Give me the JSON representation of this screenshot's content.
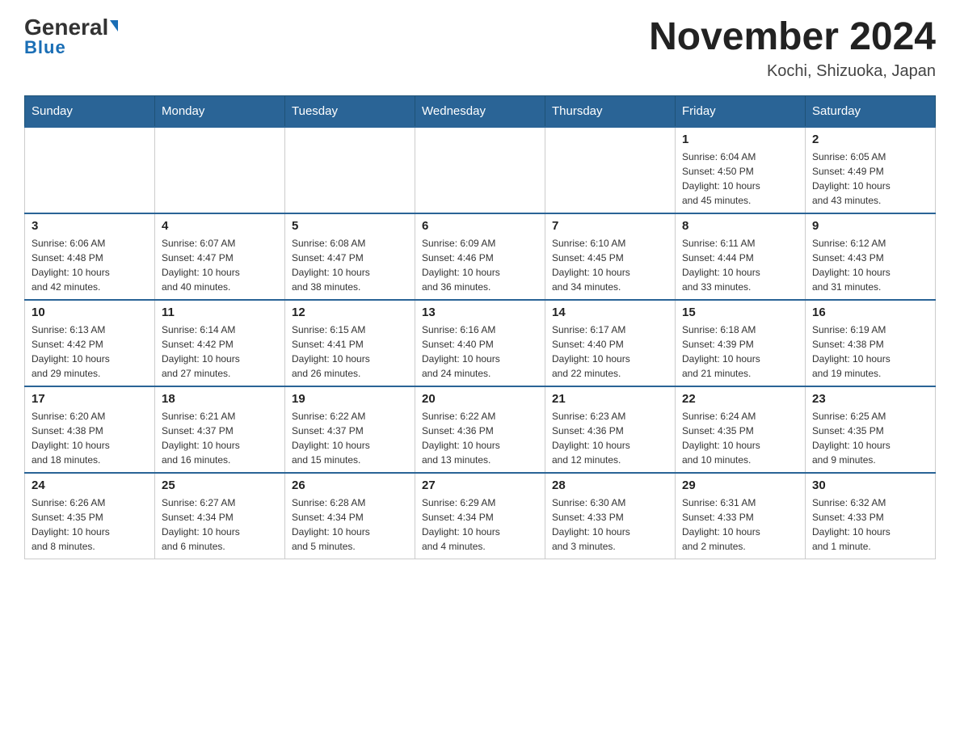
{
  "header": {
    "logo_general": "General",
    "logo_blue": "Blue",
    "month_title": "November 2024",
    "location": "Kochi, Shizuoka, Japan"
  },
  "days_of_week": [
    "Sunday",
    "Monday",
    "Tuesday",
    "Wednesday",
    "Thursday",
    "Friday",
    "Saturday"
  ],
  "weeks": [
    [
      {
        "day": "",
        "info": ""
      },
      {
        "day": "",
        "info": ""
      },
      {
        "day": "",
        "info": ""
      },
      {
        "day": "",
        "info": ""
      },
      {
        "day": "",
        "info": ""
      },
      {
        "day": "1",
        "info": "Sunrise: 6:04 AM\nSunset: 4:50 PM\nDaylight: 10 hours\nand 45 minutes."
      },
      {
        "day": "2",
        "info": "Sunrise: 6:05 AM\nSunset: 4:49 PM\nDaylight: 10 hours\nand 43 minutes."
      }
    ],
    [
      {
        "day": "3",
        "info": "Sunrise: 6:06 AM\nSunset: 4:48 PM\nDaylight: 10 hours\nand 42 minutes."
      },
      {
        "day": "4",
        "info": "Sunrise: 6:07 AM\nSunset: 4:47 PM\nDaylight: 10 hours\nand 40 minutes."
      },
      {
        "day": "5",
        "info": "Sunrise: 6:08 AM\nSunset: 4:47 PM\nDaylight: 10 hours\nand 38 minutes."
      },
      {
        "day": "6",
        "info": "Sunrise: 6:09 AM\nSunset: 4:46 PM\nDaylight: 10 hours\nand 36 minutes."
      },
      {
        "day": "7",
        "info": "Sunrise: 6:10 AM\nSunset: 4:45 PM\nDaylight: 10 hours\nand 34 minutes."
      },
      {
        "day": "8",
        "info": "Sunrise: 6:11 AM\nSunset: 4:44 PM\nDaylight: 10 hours\nand 33 minutes."
      },
      {
        "day": "9",
        "info": "Sunrise: 6:12 AM\nSunset: 4:43 PM\nDaylight: 10 hours\nand 31 minutes."
      }
    ],
    [
      {
        "day": "10",
        "info": "Sunrise: 6:13 AM\nSunset: 4:42 PM\nDaylight: 10 hours\nand 29 minutes."
      },
      {
        "day": "11",
        "info": "Sunrise: 6:14 AM\nSunset: 4:42 PM\nDaylight: 10 hours\nand 27 minutes."
      },
      {
        "day": "12",
        "info": "Sunrise: 6:15 AM\nSunset: 4:41 PM\nDaylight: 10 hours\nand 26 minutes."
      },
      {
        "day": "13",
        "info": "Sunrise: 6:16 AM\nSunset: 4:40 PM\nDaylight: 10 hours\nand 24 minutes."
      },
      {
        "day": "14",
        "info": "Sunrise: 6:17 AM\nSunset: 4:40 PM\nDaylight: 10 hours\nand 22 minutes."
      },
      {
        "day": "15",
        "info": "Sunrise: 6:18 AM\nSunset: 4:39 PM\nDaylight: 10 hours\nand 21 minutes."
      },
      {
        "day": "16",
        "info": "Sunrise: 6:19 AM\nSunset: 4:38 PM\nDaylight: 10 hours\nand 19 minutes."
      }
    ],
    [
      {
        "day": "17",
        "info": "Sunrise: 6:20 AM\nSunset: 4:38 PM\nDaylight: 10 hours\nand 18 minutes."
      },
      {
        "day": "18",
        "info": "Sunrise: 6:21 AM\nSunset: 4:37 PM\nDaylight: 10 hours\nand 16 minutes."
      },
      {
        "day": "19",
        "info": "Sunrise: 6:22 AM\nSunset: 4:37 PM\nDaylight: 10 hours\nand 15 minutes."
      },
      {
        "day": "20",
        "info": "Sunrise: 6:22 AM\nSunset: 4:36 PM\nDaylight: 10 hours\nand 13 minutes."
      },
      {
        "day": "21",
        "info": "Sunrise: 6:23 AM\nSunset: 4:36 PM\nDaylight: 10 hours\nand 12 minutes."
      },
      {
        "day": "22",
        "info": "Sunrise: 6:24 AM\nSunset: 4:35 PM\nDaylight: 10 hours\nand 10 minutes."
      },
      {
        "day": "23",
        "info": "Sunrise: 6:25 AM\nSunset: 4:35 PM\nDaylight: 10 hours\nand 9 minutes."
      }
    ],
    [
      {
        "day": "24",
        "info": "Sunrise: 6:26 AM\nSunset: 4:35 PM\nDaylight: 10 hours\nand 8 minutes."
      },
      {
        "day": "25",
        "info": "Sunrise: 6:27 AM\nSunset: 4:34 PM\nDaylight: 10 hours\nand 6 minutes."
      },
      {
        "day": "26",
        "info": "Sunrise: 6:28 AM\nSunset: 4:34 PM\nDaylight: 10 hours\nand 5 minutes."
      },
      {
        "day": "27",
        "info": "Sunrise: 6:29 AM\nSunset: 4:34 PM\nDaylight: 10 hours\nand 4 minutes."
      },
      {
        "day": "28",
        "info": "Sunrise: 6:30 AM\nSunset: 4:33 PM\nDaylight: 10 hours\nand 3 minutes."
      },
      {
        "day": "29",
        "info": "Sunrise: 6:31 AM\nSunset: 4:33 PM\nDaylight: 10 hours\nand 2 minutes."
      },
      {
        "day": "30",
        "info": "Sunrise: 6:32 AM\nSunset: 4:33 PM\nDaylight: 10 hours\nand 1 minute."
      }
    ]
  ]
}
